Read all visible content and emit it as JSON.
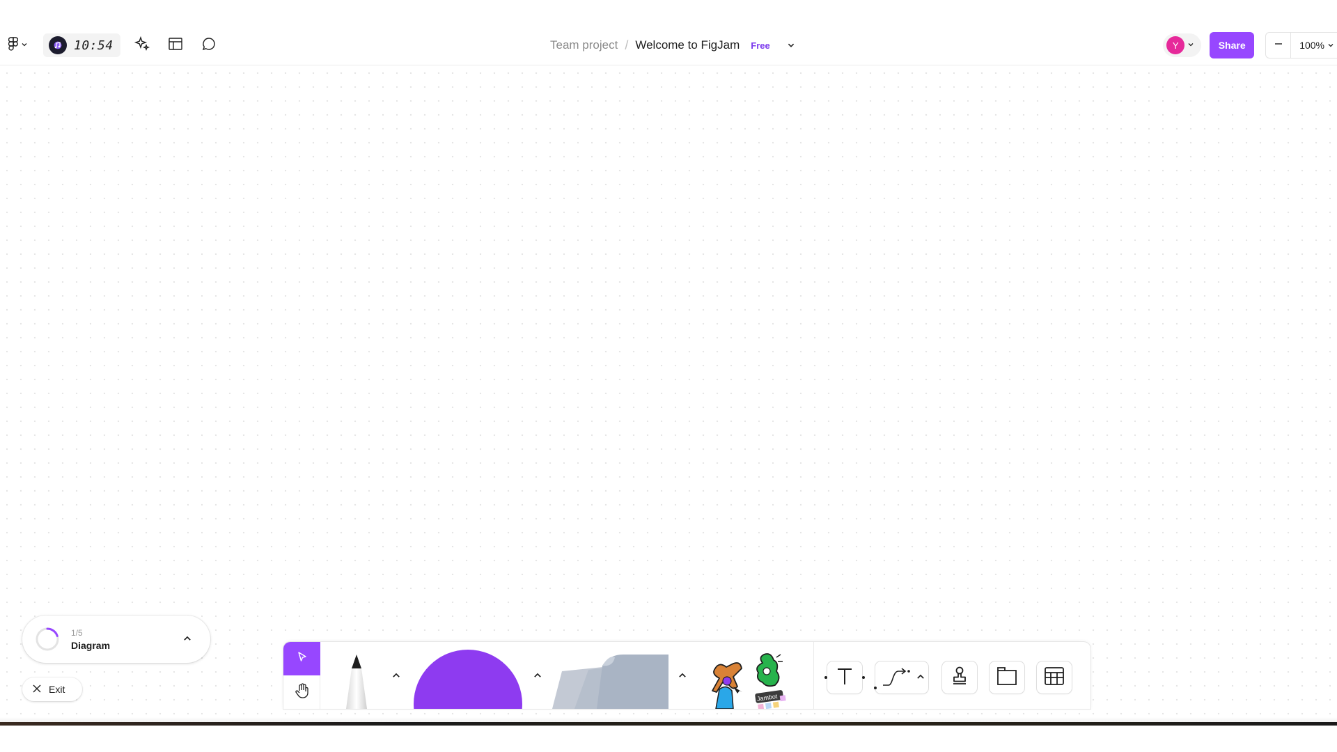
{
  "app": {
    "timer": "10:54"
  },
  "header": {
    "breadcrumb": {
      "team": "Team project",
      "separator": "/",
      "file": "Welcome to FigJam",
      "plan_badge": "Free"
    },
    "user_avatar_initial": "Y",
    "share_label": "Share",
    "zoom_level": "100%"
  },
  "onboarding": {
    "step": "1/5",
    "title": "Diagram",
    "exit_label": "Exit",
    "progress": 0.2
  },
  "toolbar": {
    "sticky_label": "Jambot"
  },
  "colors": {
    "accent": "#9747ff",
    "shape_purple": "#8e3bf0",
    "avatar_pink": "#e6299a",
    "plan_badge": "#7c3aed"
  }
}
